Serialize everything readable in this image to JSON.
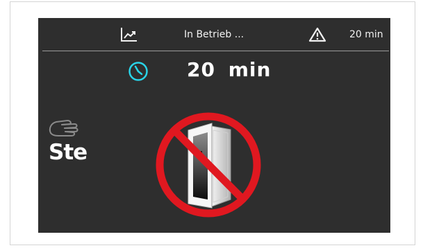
{
  "topbar": {
    "trend_icon": "trend-chart-icon",
    "status_text": "In Betrieb ...",
    "warning_icon": "warning-triangle-icon",
    "warning_time": "20 min"
  },
  "timer": {
    "clock_icon": "clock-icon",
    "value": "20  min"
  },
  "side": {
    "hand_icon": "hand-icon",
    "label": "Ste"
  },
  "main_icon": "no-door-open-icon",
  "colors": {
    "screen_bg": "#2e2e2e",
    "accent": "#29d3e8",
    "prohibit": "#e01820",
    "text": "#ffffff"
  }
}
